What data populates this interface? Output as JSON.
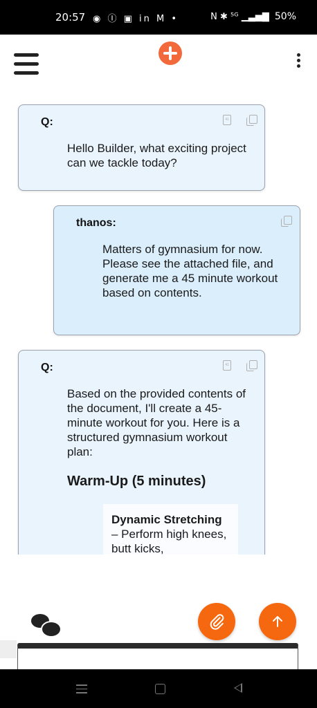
{
  "status_bar": {
    "time": "20:57",
    "left_icons": "◉ Ⓘ ▣ in M •",
    "right_icons": "N ✱ ⁵ᴳ ▁▃▅▇",
    "battery": "50%"
  },
  "toolbar": {
    "menu_icon": "hamburger-menu-icon",
    "add_icon": "plus-circle-icon",
    "more_icon": "kebab-menu-icon",
    "accent_color": "#f26a3b"
  },
  "messages": [
    {
      "speaker": "Q:",
      "text": "Hello Builder, what exciting project can we tackle today?"
    },
    {
      "speaker": "thanos:",
      "text": "Matters of gymnasium for now. Please see the attached file, and generate me a 45 minute workout based on contents."
    },
    {
      "speaker": "Q:",
      "text": "Based on the provided contents of the document, I'll create a 45-minute workout for you. Here is a structured gymnasium workout plan:",
      "heading": "Warm-Up (5 minutes)",
      "item_title": "Dynamic Stretching",
      "item_text": "– Perform high knees, butt kicks,"
    }
  ],
  "fabs": {
    "attach_icon": "paperclip-icon",
    "send_icon": "arrow-up-icon",
    "color": "#f5680f"
  },
  "chat_toggle_icon": "chat-bubbles-icon"
}
